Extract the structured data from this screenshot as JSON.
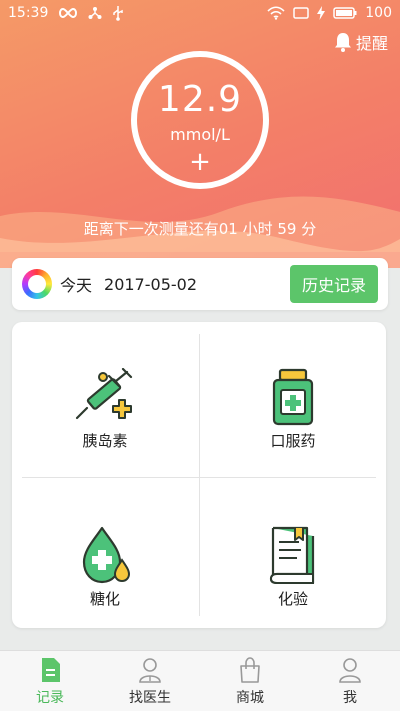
{
  "status_bar": {
    "time": "15:39",
    "battery": "100",
    "icons": [
      "infinity-icon",
      "share-icon",
      "usb-icon",
      "wifi-icon",
      "screen-icon",
      "charging-icon",
      "battery-icon"
    ]
  },
  "header": {
    "reminder_label": "提醒",
    "reminder_icon": "bell-icon"
  },
  "reading": {
    "value": "12.9",
    "unit": "mmol/L",
    "add_symbol": "+"
  },
  "next_measure": "距离下一次测量还有01 小时 59 分",
  "date_bar": {
    "today_label": "今天",
    "date": "2017-05-02",
    "history_button": "历史记录"
  },
  "grid": [
    {
      "label": "胰岛素",
      "icon": "syringe-icon"
    },
    {
      "label": "口服药",
      "icon": "pill-bottle-icon"
    },
    {
      "label": "糖化",
      "icon": "blood-drop-icon"
    },
    {
      "label": "化验",
      "icon": "report-icon"
    }
  ],
  "tabs": [
    {
      "label": "记录",
      "icon": "record-icon",
      "active": true
    },
    {
      "label": "找医生",
      "icon": "doctor-icon",
      "active": false
    },
    {
      "label": "商城",
      "icon": "shop-bag-icon",
      "active": false
    },
    {
      "label": "我",
      "icon": "profile-icon",
      "active": false
    }
  ],
  "colors": {
    "accent_green": "#5cc56a",
    "hero_orange": "#f37f68",
    "icon_dark": "#2d3a2e"
  }
}
